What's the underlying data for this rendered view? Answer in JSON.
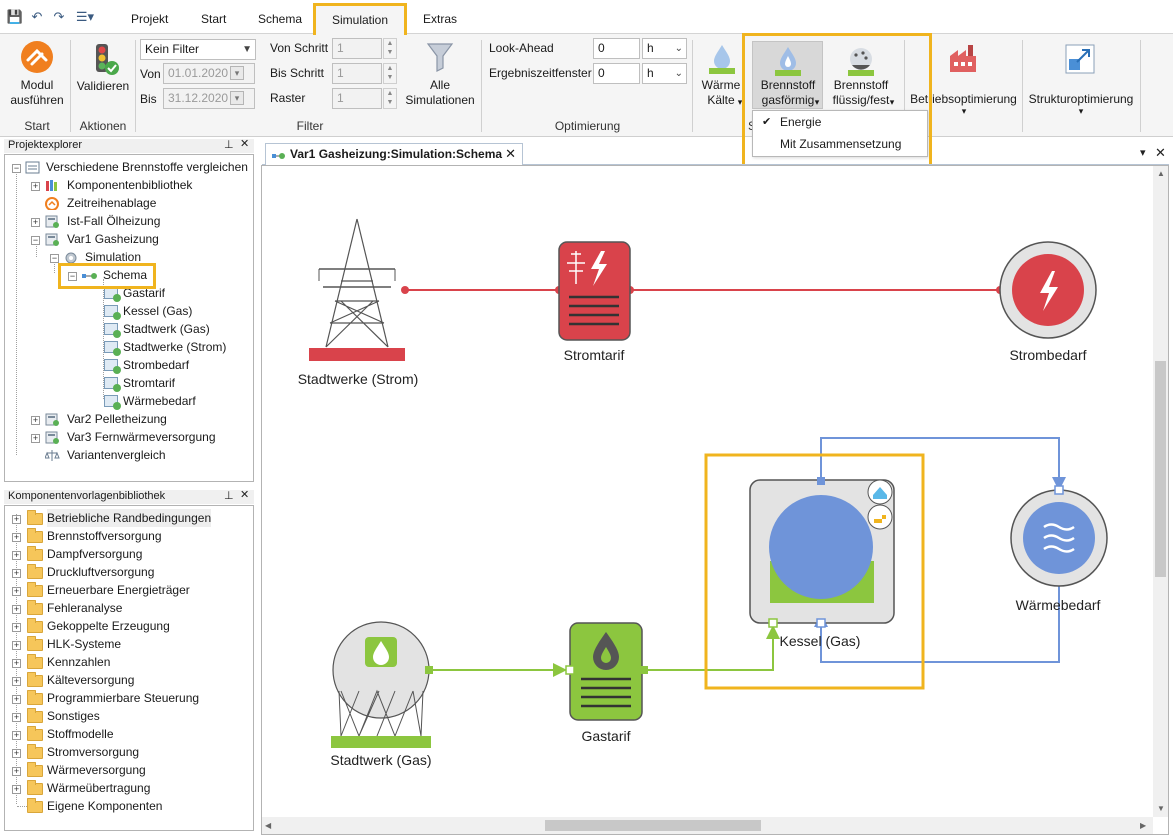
{
  "ribbon": {
    "tabs": [
      "Projekt",
      "Start",
      "Schema",
      "Simulation",
      "Extras"
    ],
    "active_tab": "Simulation",
    "groups": {
      "start": {
        "label": "Start",
        "modul_button": "Modul\nausführen"
      },
      "aktionen": {
        "label": "Aktionen",
        "validieren_button": "Validieren"
      },
      "filter": {
        "label": "Filter",
        "filter_combo": "Kein Filter",
        "von_label": "Von",
        "von_value": "01.01.2020",
        "bis_label": "Bis",
        "bis_value": "31.12.2020",
        "von_schritt_label": "Von Schritt",
        "von_schritt_value": "1",
        "bis_schritt_label": "Bis Schritt",
        "bis_schritt_value": "1",
        "raster_label": "Raster",
        "raster_value": "1",
        "alle_simulationen_button": "Alle\nSimulationen"
      },
      "optimierung": {
        "label": "Optimierung",
        "lookahead_label": "Look-Ahead",
        "lookahead_value": "0",
        "lookahead_unit": "h",
        "ergebnis_label": "Ergebniszeitfenster",
        "ergebnis_value": "0",
        "ergebnis_unit": "h"
      },
      "waerme_button": "Wärme\nKälte",
      "waerme_arrow": "▾",
      "group_s_label": "S",
      "brennstoff_gas_button": "Brennstoff\ngasförmig",
      "brennstoff_fluessig_button": "Brennstoff\nflüssig/fest",
      "betriebsoptimierung_button": "Betriebsoptimierung",
      "strukturoptimierung_button": "Strukturoptimierung"
    },
    "dropdown": {
      "items": [
        {
          "label": "Energie",
          "checked": true
        },
        {
          "label": "Mit Zusammensetzung",
          "checked": false
        }
      ]
    }
  },
  "project_explorer": {
    "title": "Projektexplorer",
    "items": [
      "Verschiedene Brennstoffe vergleichen",
      "Komponentenbibliothek",
      "Zeitreihenablage",
      "Ist-Fall Ölheizung",
      "Var1 Gasheizung",
      "Simulation",
      "Schema",
      "Gastarif",
      "Kessel (Gas)",
      "Stadtwerk (Gas)",
      "Stadtwerke (Strom)",
      "Strombedarf",
      "Stromtarif",
      "Wärmebedarf",
      "Var2 Pelletheizung",
      "Var3 Fernwärmeversorgung",
      "Variantenvergleich"
    ]
  },
  "library": {
    "title": "Komponentenvorlagenbibliothek",
    "items": [
      "Betriebliche Randbedingungen",
      "Brennstoffversorgung",
      "Dampfversorgung",
      "Druckluftversorgung",
      "Erneuerbare Energieträger",
      "Fehleranalyse",
      "Gekoppelte Erzeugung",
      "HLK-Systeme",
      "Kennzahlen",
      "Kälteversorgung",
      "Programmierbare Steuerung",
      "Sonstiges",
      "Stoffmodelle",
      "Stromversorgung",
      "Wärmeversorgung",
      "Wärmeübertragung",
      "Eigene Komponenten"
    ]
  },
  "document": {
    "tab_title": "Var1 Gasheizung:Simulation:Schema",
    "nodes": {
      "stadtwerke_strom": "Stadtwerke (Strom)",
      "stromtarif": "Stromtarif",
      "strombedarf": "Strombedarf",
      "kessel": "Kessel (Gas)",
      "waermebedarf": "Wärmebedarf",
      "stadtwerk_gas": "Stadtwerk (Gas)",
      "gastarif": "Gastarif"
    }
  },
  "colors": {
    "highlight": "#f0b41e",
    "electric": "#d9434b",
    "gas": "#8cc63f",
    "heat": "#6f94d9"
  }
}
